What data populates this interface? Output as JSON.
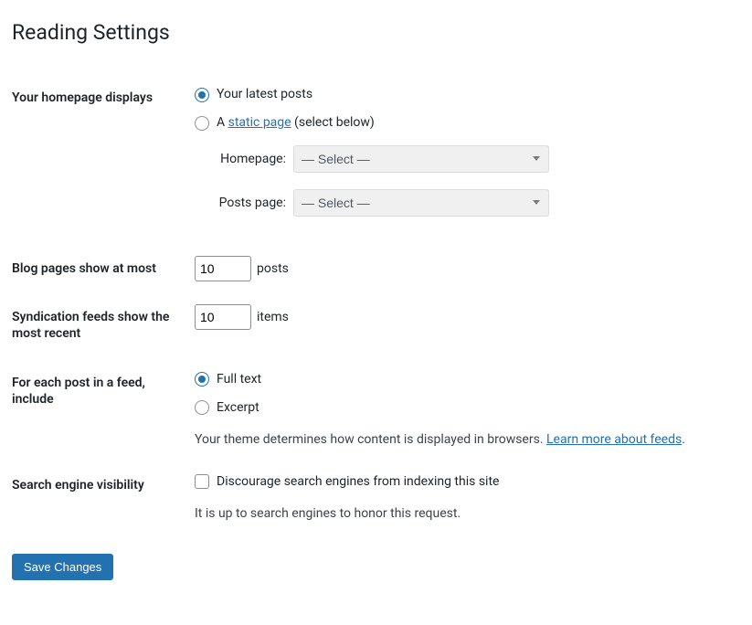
{
  "title": "Reading Settings",
  "homepage": {
    "label": "Your homepage displays",
    "option_latest": "Your latest posts",
    "option_static_prefix": "A ",
    "option_static_link": "static page",
    "option_static_suffix": " (select below)",
    "homepage_label": "Homepage:",
    "postspage_label": "Posts page:",
    "select_placeholder": "— Select —"
  },
  "blog_pages": {
    "label": "Blog pages show at most",
    "value": "10",
    "suffix": "posts"
  },
  "syndication": {
    "label": "Syndication feeds show the most recent",
    "value": "10",
    "suffix": "items"
  },
  "feed_include": {
    "label": "For each post in a feed, include",
    "option_full": "Full text",
    "option_excerpt": "Excerpt",
    "description_prefix": "Your theme determines how content is displayed in browsers. ",
    "description_link": "Learn more about feeds",
    "description_suffix": "."
  },
  "search_engine": {
    "label": "Search engine visibility",
    "checkbox_label": "Discourage search engines from indexing this site",
    "description": "It is up to search engines to honor this request."
  },
  "submit": "Save Changes"
}
